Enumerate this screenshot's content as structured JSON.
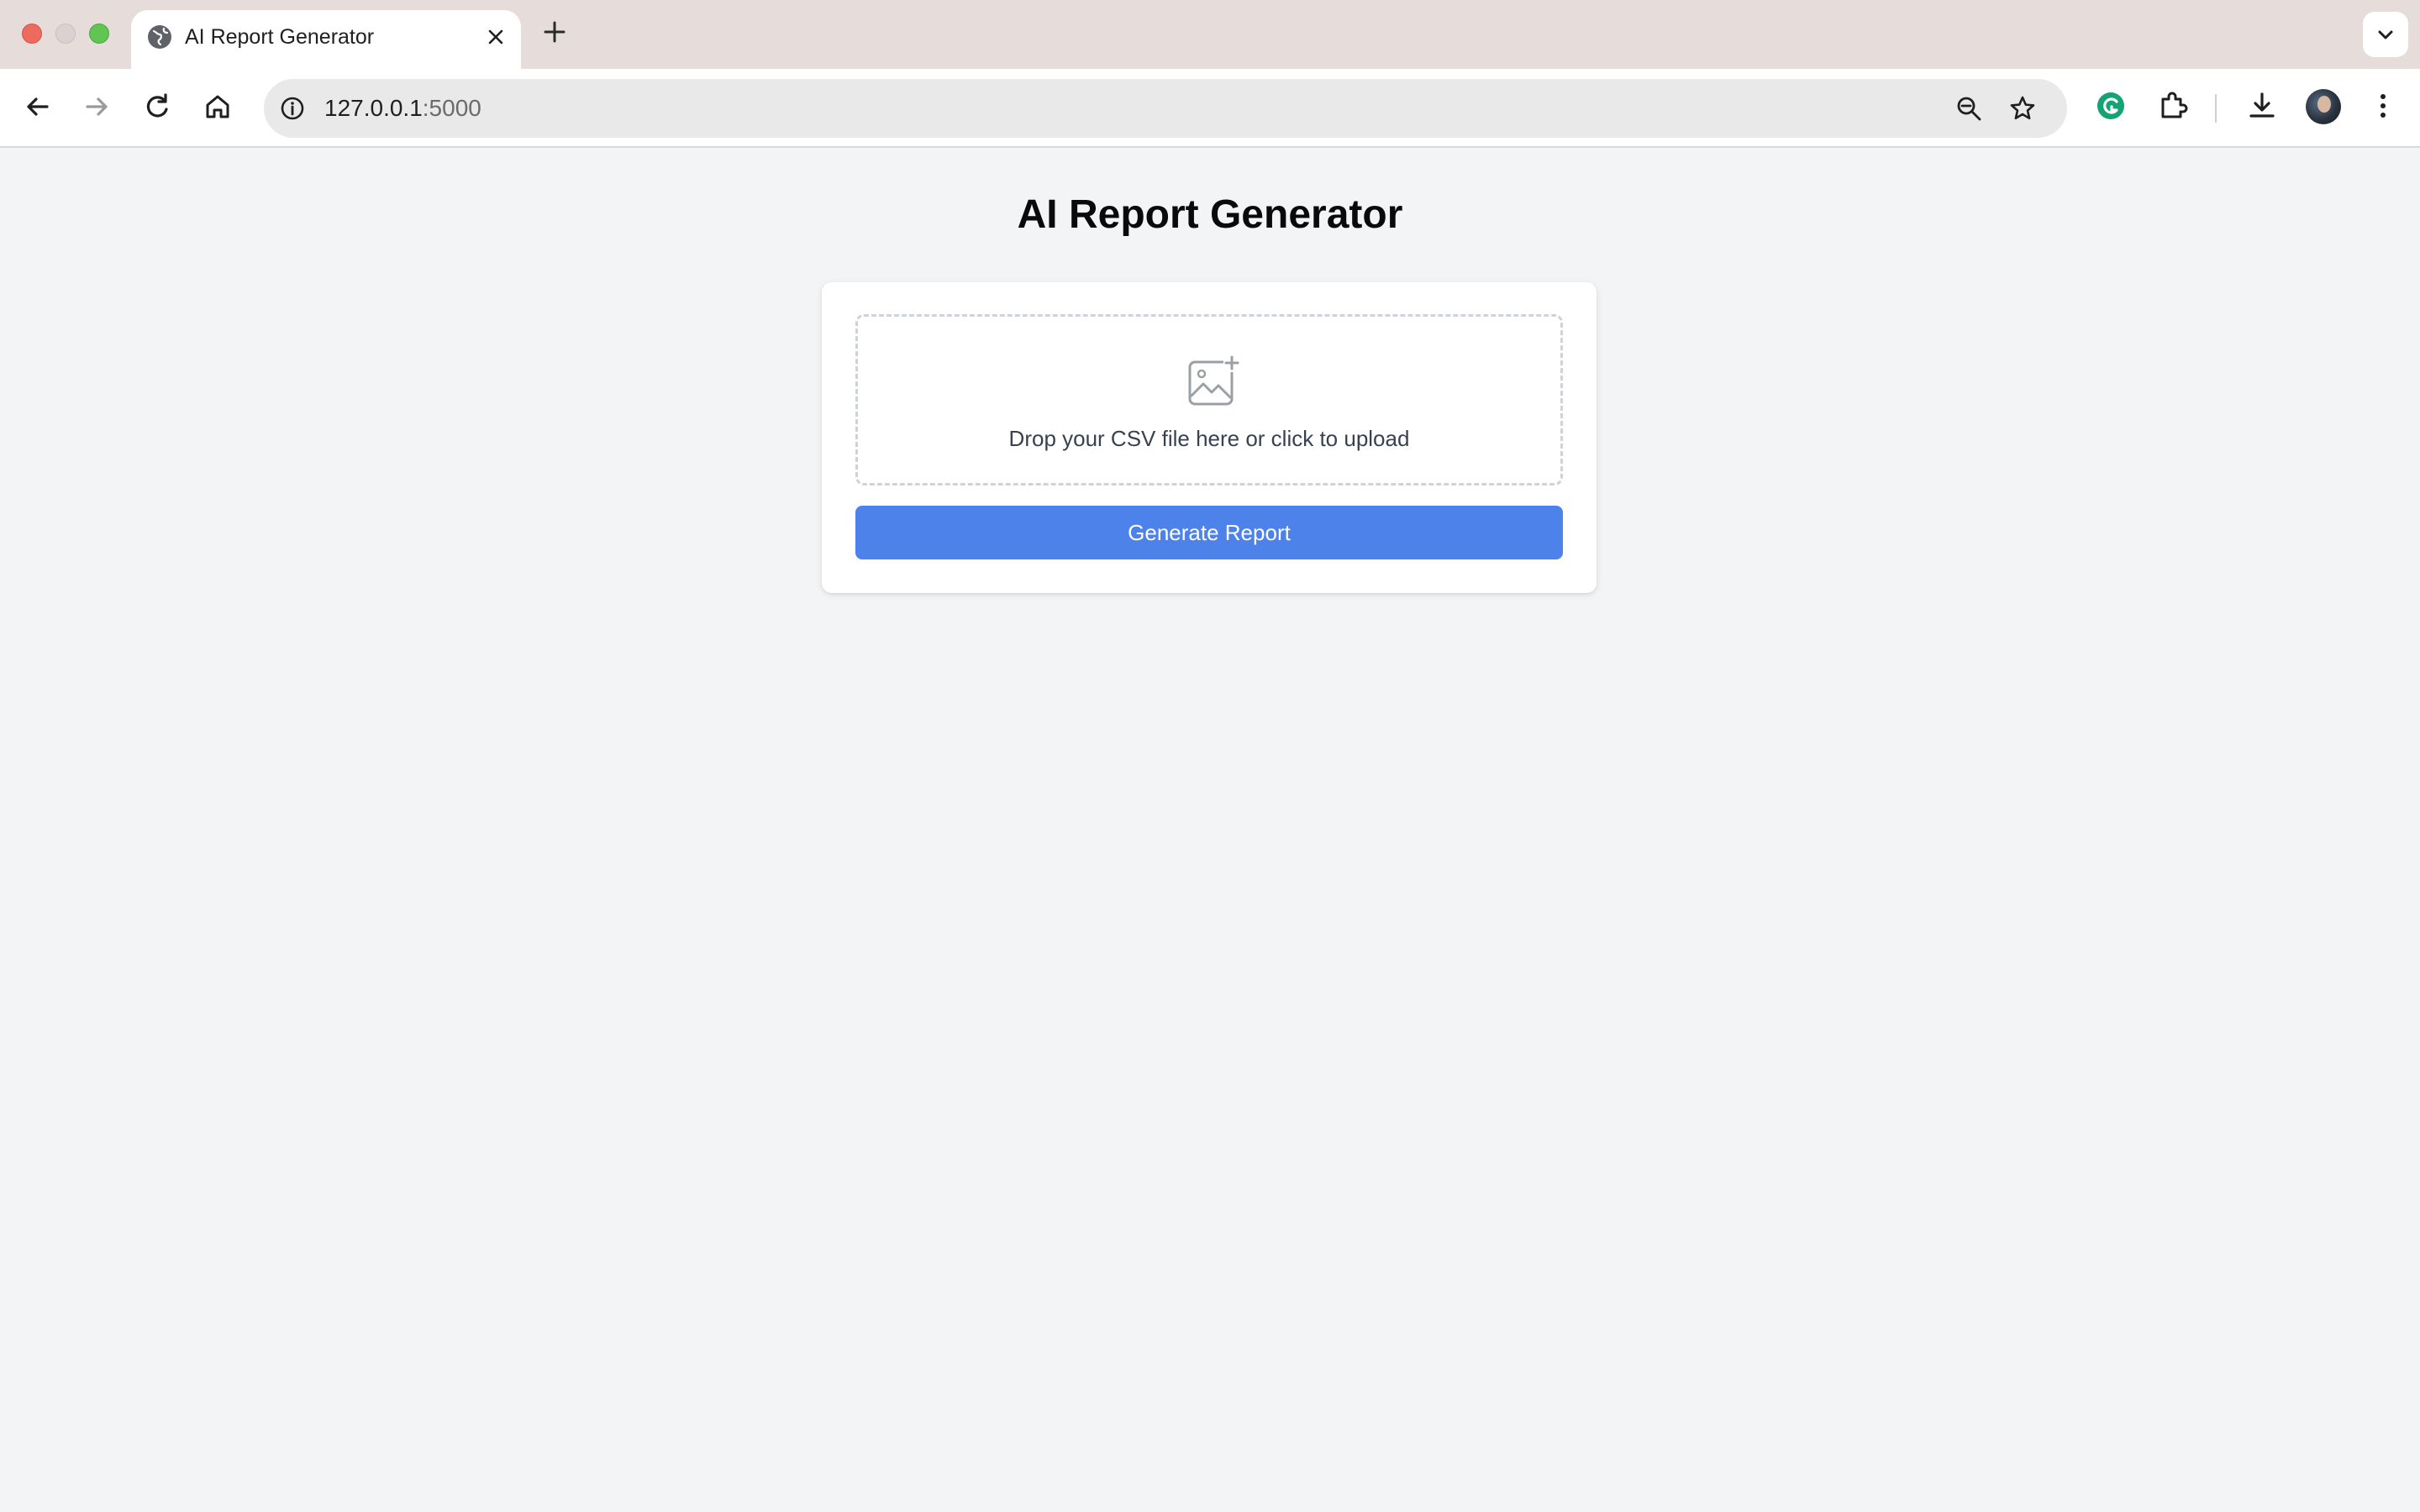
{
  "browser": {
    "tab": {
      "title": "AI Report Generator"
    },
    "address_bar": {
      "host": "127.0.0.1",
      "port": ":5000"
    },
    "icons": {
      "back": "arrow-left-icon",
      "forward": "arrow-right-icon",
      "reload": "reload-icon",
      "home": "home-icon",
      "site_info": "info-icon",
      "zoom": "zoom-out-icon",
      "bookmark": "star-icon",
      "grammarly": "grammarly-icon",
      "extensions": "puzzle-icon",
      "downloads": "download-icon",
      "menu": "kebab-menu-icon"
    }
  },
  "page": {
    "title": "AI Report Generator",
    "upload": {
      "prompt": "Drop your CSV file here or click to upload",
      "icon": "image-add-icon"
    },
    "generate_button": "Generate Report",
    "colors": {
      "background": "#f3f4f6",
      "button": "#4d82ea",
      "card": "#ffffff"
    }
  }
}
